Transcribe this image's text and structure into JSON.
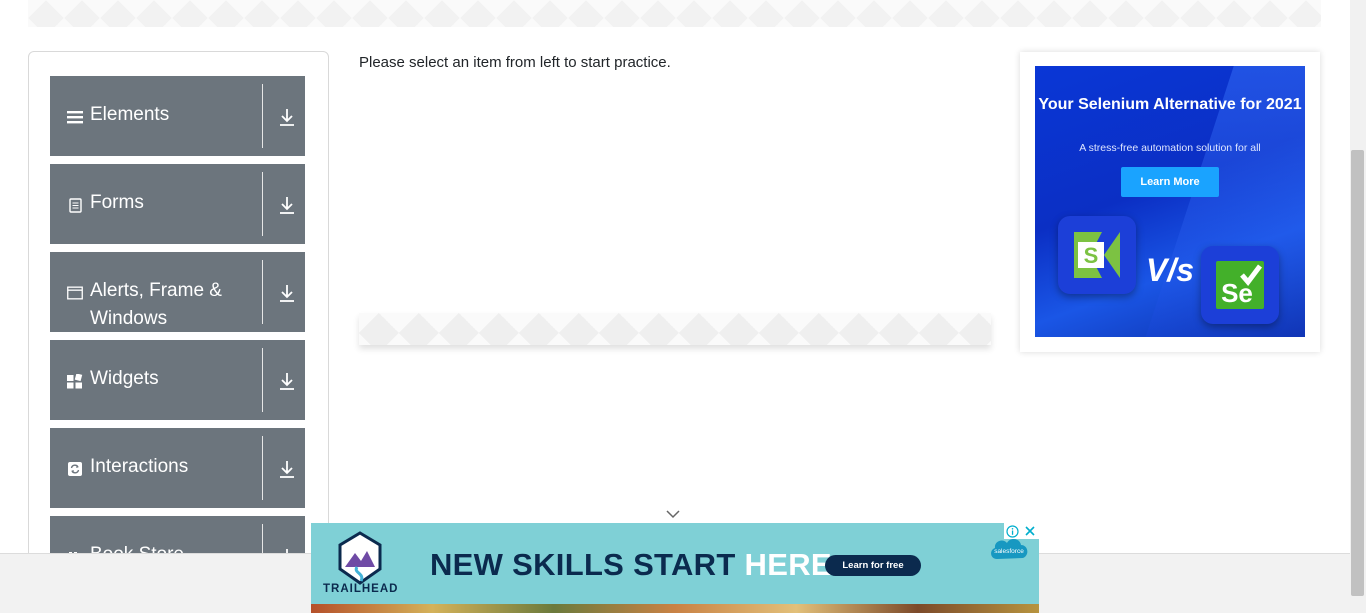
{
  "instruction": "Please select an item from left to start practice.",
  "sidebar": {
    "groups": [
      {
        "label": "Elements",
        "icon": "hamburger-icon"
      },
      {
        "label": "Forms",
        "icon": "document-icon"
      },
      {
        "label": "Alerts, Frame & Windows",
        "icon": "window-icon"
      },
      {
        "label": "Widgets",
        "icon": "grid-icon"
      },
      {
        "label": "Interactions",
        "icon": "refresh-icon"
      },
      {
        "label": "Book Store",
        "icon": "book-icon"
      }
    ]
  },
  "side_ad": {
    "title": "Your Selenium Alternative for 2021",
    "subtitle": "A stress-free automation solution for all",
    "button": "Learn More",
    "vs": "V/s",
    "left_logo": "S",
    "right_logo": "Se"
  },
  "bottom_ad": {
    "brand": "TRAILHEAD",
    "headline_dark": "NEW SKILLS START",
    "headline_light": "HERE.",
    "button": "Learn for free",
    "partner": "salesforce"
  },
  "colors": {
    "sidebar_group": "#6c757d",
    "ad_blue": "#0a37d6",
    "ad_button": "#1aa3ff",
    "trailhead_bg": "#7fd0d6",
    "trailhead_navy": "#0b2a4e"
  }
}
